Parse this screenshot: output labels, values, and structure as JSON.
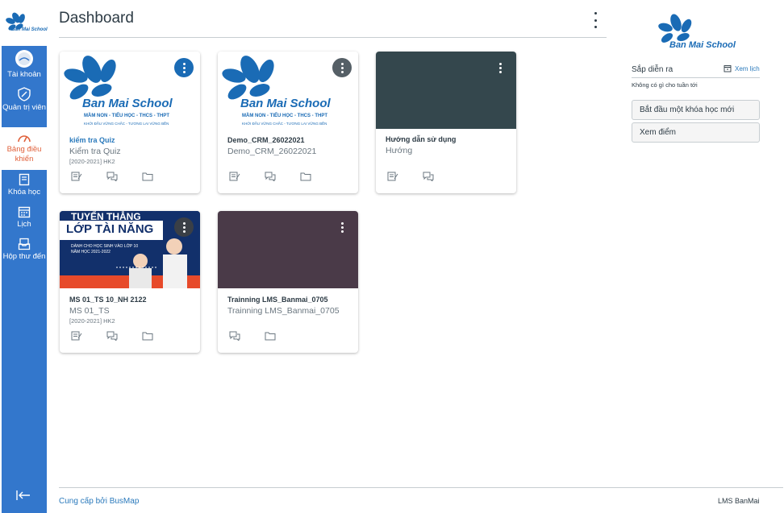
{
  "colors": {
    "nav_bg": "#3377cc",
    "accent_active": "#e0603a",
    "link": "#2b7abc",
    "text": "#2d3b45"
  },
  "nav": {
    "logo_text": "Ban Mai School",
    "items": [
      {
        "label": "Tài khoản",
        "icon": "user-avatar-icon"
      },
      {
        "label": "Quản trị viên",
        "icon": "shield-icon"
      },
      {
        "label": "Bảng điều khiển",
        "icon": "dashboard-gauge-icon",
        "active": true
      },
      {
        "label": "Khóa học",
        "icon": "book-icon"
      },
      {
        "label": "Lịch",
        "icon": "calendar-icon"
      },
      {
        "label": "Hộp thư đến",
        "icon": "inbox-icon"
      }
    ],
    "collapse_icon": "collapse-arrow-icon"
  },
  "page": {
    "title": "Dashboard"
  },
  "cards": [
    {
      "code": "kiểm tra Quiz",
      "name": "Kiểm tra Quiz",
      "term": "[2020-2021] HK2",
      "hero": "banmai-logo",
      "menu_color": "#1a6bb5",
      "actions": [
        "assignments-icon",
        "discussions-icon",
        "files-icon"
      ],
      "hero_text": {
        "brand": "Ban Mai School",
        "line1": "MẦM NON - TIỂU HỌC - THCS - THPT",
        "line2": "KHỞI ĐẦU VỮNG CHẮC - TƯƠNG LAI VỮNG BỀN"
      }
    },
    {
      "code": "Demo_CRM_26022021",
      "name": "Demo_CRM_26022021",
      "term": "",
      "hero": "banmai-logo",
      "menu_color": "#555f66",
      "actions": [
        "assignments-icon",
        "discussions-icon",
        "files-icon"
      ],
      "hero_text": {
        "brand": "Ban Mai School",
        "line1": "MẦM NON - TIỂU HỌC - THCS - THPT",
        "line2": "KHỞI ĐẦU VỮNG CHẮC - TƯƠNG LAI VỮNG BỀN"
      }
    },
    {
      "code": "Hướng dẫn sử dụng",
      "name": "Hướng",
      "term": "",
      "hero": "solid",
      "hero_color": "#34474d",
      "actions": [
        "assignments-icon",
        "discussions-icon"
      ]
    },
    {
      "code": "MS 01_TS 10_NH 2122",
      "name": "MS 01_TS",
      "term": "[2020-2021] HK2",
      "hero": "poster",
      "actions": [
        "assignments-icon",
        "discussions-icon",
        "files-icon"
      ],
      "hero_text": {
        "line1": "TUYỂN THẲNG",
        "line2": "LỚP TÀI NĂNG",
        "line3": "DÀNH CHO HỌC SINH VÀO LỚP 10",
        "line4": "NĂM HỌC 2021-2022"
      }
    },
    {
      "code": "Trainning LMS_Banmai_0705",
      "name": "Trainning LMS_Banmai_0705",
      "term": "",
      "hero": "solid",
      "hero_color": "#4a3a48",
      "actions": [
        "discussions-icon",
        "files-icon"
      ]
    }
  ],
  "sidebar": {
    "logo_text": "Ban Mai School",
    "coming_up": "Sắp diễn ra",
    "calendar_link": "Xem lịch",
    "empty": "Không có gì cho tuần tới",
    "buttons": [
      "Bắt đầu một khóa học mới",
      "Xem điểm"
    ]
  },
  "footer": {
    "left": "Cung cấp bởi BusMap",
    "right": "LMS BanMai"
  }
}
